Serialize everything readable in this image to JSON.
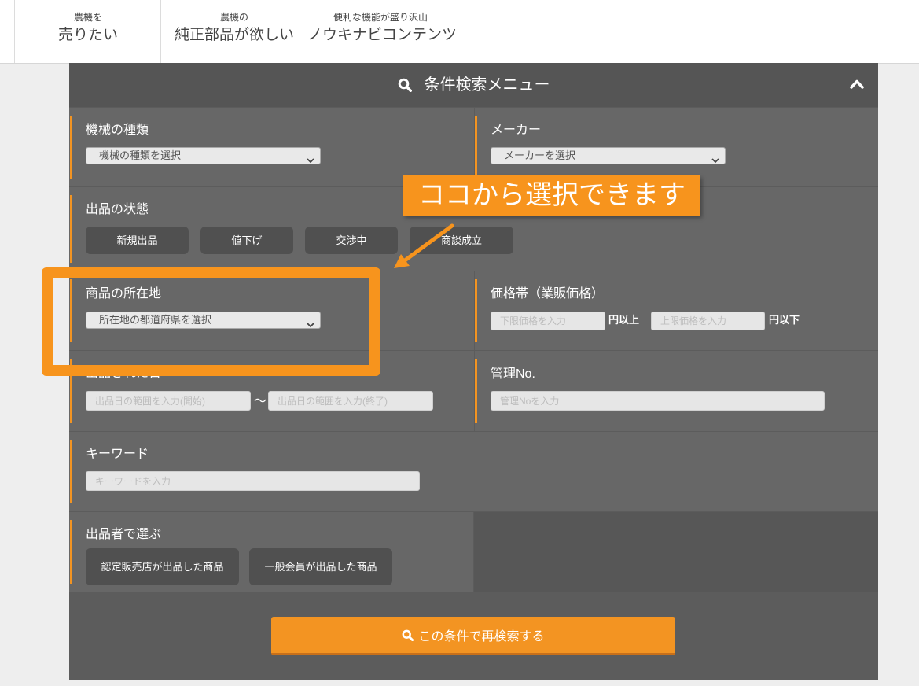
{
  "nav": {
    "tabs": [
      {
        "sub": "農機を",
        "main": "売りたい"
      },
      {
        "sub": "農機の",
        "main": "純正部品が欲しい"
      },
      {
        "sub": "便利な機能が盛り沢山",
        "main": "ノウキナビコンテンツ"
      }
    ]
  },
  "panel": {
    "title": "条件検索メニュー",
    "title_icon": "search-icon",
    "toggle_icon": "chevron-up-icon"
  },
  "fields": {
    "machine_type": {
      "label": "機械の種類",
      "selected": "機械の種類を選択"
    },
    "maker": {
      "label": "メーカー",
      "selected": "メーカーを選択"
    },
    "status": {
      "label": "出品の状態",
      "options": [
        "新規出品",
        "値下げ",
        "交渉中",
        "商談成立"
      ]
    },
    "location": {
      "label": "商品の所在地",
      "selected": "所在地の都道府県を選択"
    },
    "price": {
      "label": "価格帯（業販価格）",
      "min_placeholder": "下限価格を入力",
      "min_suffix": "円以上",
      "max_placeholder": "上限価格を入力",
      "max_suffix": "円以下"
    },
    "date": {
      "label": "出品された日",
      "start_placeholder": "出品日の範囲を入力(開始)",
      "separator": "～",
      "end_placeholder": "出品日の範囲を入力(終了)"
    },
    "management_no": {
      "label": "管理No.",
      "placeholder": "管理Noを入力"
    },
    "keyword": {
      "label": "キーワード",
      "placeholder": "キーワードを入力"
    },
    "seller": {
      "label": "出品者で選ぶ",
      "options": [
        "認定販売店が出品した商品",
        "一般会員が出品した商品"
      ]
    }
  },
  "submit": {
    "label": "この条件で再検索する",
    "icon": "search-icon"
  },
  "annotation": {
    "callout": "ココから選択できます"
  },
  "colors": {
    "accent": "#f39422",
    "annotation": "#f7941d",
    "page_bg": "#eeeeee",
    "panel": "#5c5c5c",
    "header": "#555555",
    "cell": "#676767",
    "empty_cell": "#575757",
    "button": "#505050",
    "input": "#e6e6e6",
    "nav_text": "#444444"
  }
}
